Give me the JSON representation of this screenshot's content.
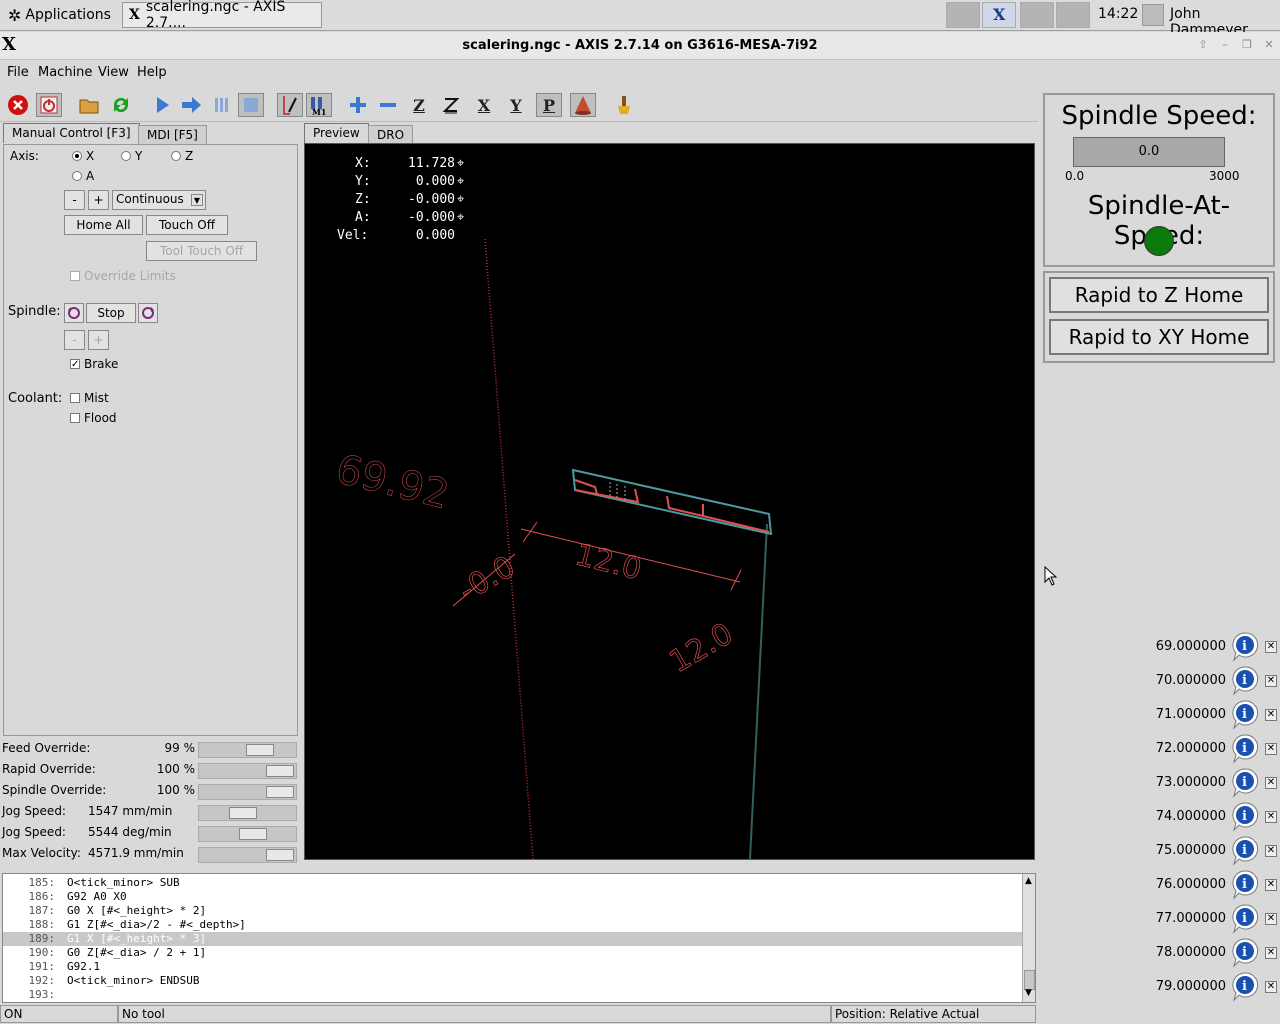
{
  "taskbar": {
    "apps_label": "Applications",
    "task_title": "scalering.ngc - AXIS 2.7....",
    "clock": "14:22",
    "user": "John Dammeyer"
  },
  "window": {
    "title": "scalering.ngc - AXIS 2.7.14 on G3616-MESA-7i92"
  },
  "menu": [
    "File",
    "Machine",
    "View",
    "Help"
  ],
  "toolbar": {
    "z_label": "Z",
    "x_label": "X",
    "y_label": "Y",
    "p_label": "P"
  },
  "tabs_left": [
    "Manual Control [F3]",
    "MDI [F5]"
  ],
  "tabs_right": [
    "Preview",
    "DRO"
  ],
  "manual": {
    "axis_label": "Axis:",
    "axes": [
      "X",
      "Y",
      "Z",
      "A"
    ],
    "axis_selected": "X",
    "jog_minus": "-",
    "jog_plus": "+",
    "jog_mode": "Continuous",
    "home_all": "Home All",
    "touch_off": "Touch Off",
    "tool_touch_off": "Tool Touch Off",
    "override_limits": "Override Limits",
    "spindle_label": "Spindle:",
    "spindle_stop": "Stop",
    "spindle_minus": "-",
    "spindle_plus": "+",
    "brake_label": "Brake",
    "brake_checked": true,
    "coolant_label": "Coolant:",
    "mist_label": "Mist",
    "flood_label": "Flood"
  },
  "overrides": [
    {
      "label": "Feed Override:",
      "value": "99 %",
      "fraction": 0.7
    },
    {
      "label": "Rapid Override:",
      "value": "100 %",
      "fraction": 1.0
    },
    {
      "label": "Spindle Override:",
      "value": "100 %",
      "fraction": 1.0
    },
    {
      "label": "Jog Speed:",
      "value": "1547 mm/min",
      "fraction": 0.45
    },
    {
      "label": "Jog Speed:",
      "value": "5544 deg/min",
      "fraction": 0.6
    },
    {
      "label": "Max Velocity:",
      "value": "4571.9 mm/min",
      "fraction": 1.0
    }
  ],
  "dro": [
    {
      "label": "X:",
      "value": "11.728"
    },
    {
      "label": "Y:",
      "value": "0.000"
    },
    {
      "label": "Z:",
      "value": "-0.000"
    },
    {
      "label": "A:",
      "value": "-0.000"
    },
    {
      "label": "Vel:",
      "value": "0.000"
    }
  ],
  "preview_text": {
    "label_a": "69.92",
    "label_b": "-0.0",
    "label_c": "12.0",
    "label_d": "12.0"
  },
  "code": {
    "lines": [
      {
        "n": "185:",
        "t": "O<tick_minor> SUB"
      },
      {
        "n": "186:",
        "t": "G92 A0 X0"
      },
      {
        "n": "187:",
        "t": "G0 X [#<_height> * 2]"
      },
      {
        "n": "188:",
        "t": "G1 Z[#<_dia>/2 - #<_depth>]"
      },
      {
        "n": "189:",
        "t": "G1 X [#<_height> * 3]"
      },
      {
        "n": "190:",
        "t": "G0 Z[#<_dia> / 2 + 1]"
      },
      {
        "n": "191:",
        "t": "G92.1"
      },
      {
        "n": "192:",
        "t": "O<tick_minor> ENDSUB"
      },
      {
        "n": "193:",
        "t": ""
      }
    ],
    "highlight": 4
  },
  "status": {
    "state": "ON",
    "tool": "No tool",
    "position": "Position: Relative Actual"
  },
  "spindle_panel": {
    "speed_title": "Spindle Speed:",
    "speed_value": "0.0",
    "min": "0.0",
    "max": "3000",
    "at_speed_title": "Spindle-At-Speed:",
    "led_color": "#0a7a0a"
  },
  "rapid": {
    "z_home": "Rapid to Z Home",
    "xy_home": "Rapid to XY Home"
  },
  "params": [
    "69.000000",
    "70.000000",
    "71.000000",
    "72.000000",
    "73.000000",
    "74.000000",
    "75.000000",
    "76.000000",
    "77.000000",
    "78.000000",
    "79.000000"
  ],
  "colors": {
    "toolpath_feed": "#e05050",
    "toolpath_rapid": "#4a9aa0"
  }
}
